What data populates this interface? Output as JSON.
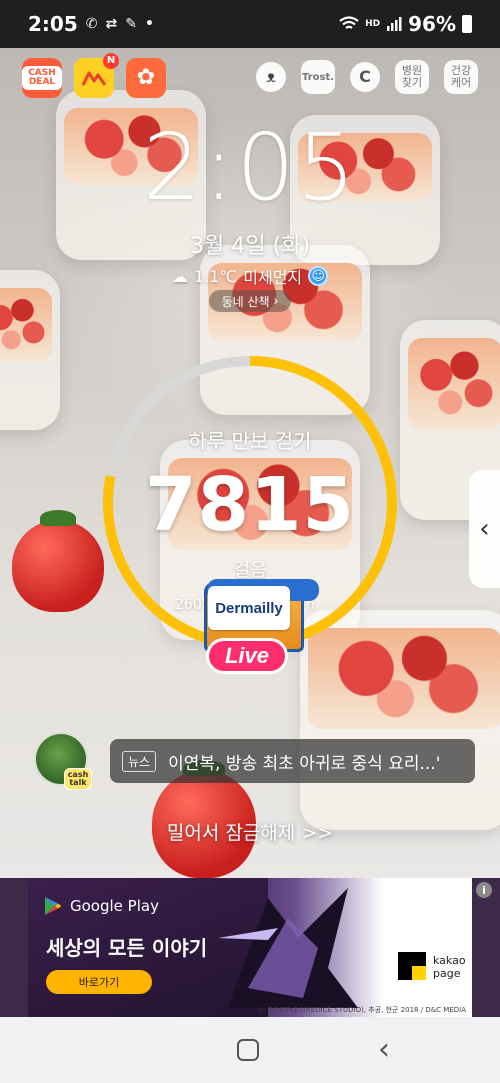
{
  "status_bar": {
    "time": "2:05",
    "battery": "96%",
    "hd_voice": "HD",
    "icons": [
      "call-icon",
      "link-icon",
      "edit-icon",
      "dot-icon",
      "wifi-icon",
      "signal-icon",
      "battery-icon"
    ]
  },
  "shortcuts": {
    "cashdeal_label": "CASH DEAL",
    "badge": "N"
  },
  "utilities": {
    "trost_label": "Trost.",
    "hospital_label": "병원 찾기",
    "health_label": "건강 케어"
  },
  "clock": {
    "time": "2:05",
    "date": "3월 4일 (화)"
  },
  "weather": {
    "temperature": "1.1℃",
    "dust_label": "미세먼지",
    "walk_label": "동네 산책"
  },
  "steps": {
    "title": "하루 만보 걷기",
    "count": "7815",
    "unit": "걸음",
    "sub_left": "260",
    "sub_right": "n",
    "progress": 0.78
  },
  "live": {
    "brand": "Dermailly",
    "label": "Live"
  },
  "news": {
    "tag": "뉴스",
    "headline": "이연복, 방송 최초 아귀로 중식 요리...'",
    "cashtalk_label": "cash talk"
  },
  "unlock_hint": "밀어서 잠금해제 >>",
  "ad": {
    "store_label": "Google Play",
    "headline": "세상의 모든 이야기",
    "cta_label": "바로가기",
    "kakao_label": "kakao page",
    "copyright": "ⓒ DISCIPLES(REDICE STUDIO), 추공, 현군 2018 / D&C MEDIA",
    "info_label": "i"
  },
  "colors": {
    "ring_progress": "#ffc107",
    "ring_track": "#d8d8d8",
    "live_pink": "#ff2d6f",
    "cta_yellow": "#ffb400"
  }
}
